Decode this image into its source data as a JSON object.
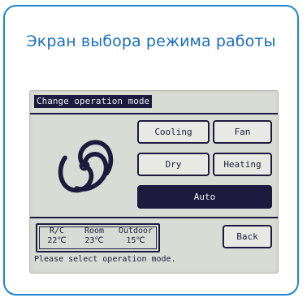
{
  "caption": "Экран выбора режима работы",
  "screen": {
    "title": "Change operation mode",
    "buttons": {
      "cooling": "Cooling",
      "fan": "Fan",
      "dry": "Dry",
      "heating": "Heating",
      "auto": "Auto"
    },
    "selected_mode": "Auto",
    "temps": {
      "rc_label": "R/C",
      "rc_value": "22℃",
      "room_label": "Room",
      "room_value": "23℃",
      "outdoor_label": "Outdoor",
      "outdoor_value": "15℃"
    },
    "back_label": "Back",
    "status": "Please select operation mode."
  },
  "icons": {
    "mode_icon": "fan-swirl-icon"
  },
  "colors": {
    "accent": "#1f84d6",
    "lcd_background": "#d9dbd5",
    "lcd_ink": "#1d1a3d"
  }
}
